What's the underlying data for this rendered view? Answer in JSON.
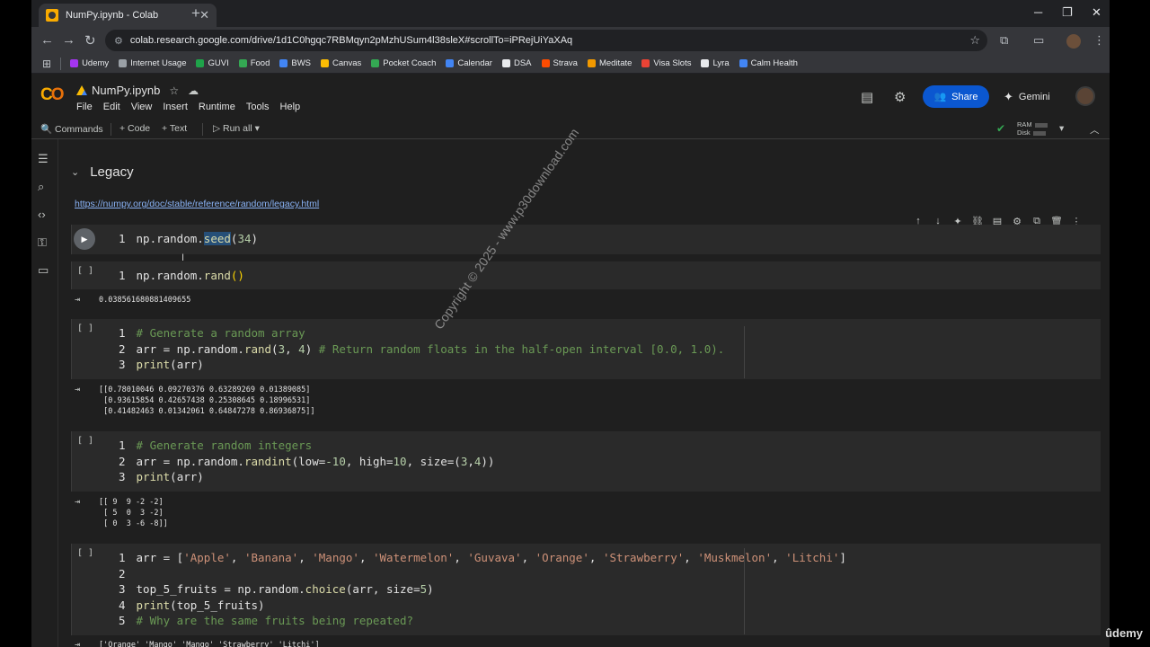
{
  "browser": {
    "tab_title": "NumPy.ipynb - Colab",
    "url": "colab.research.google.com/drive/1d1C0hgqc7RBMqyn2pMzhUSum4l38sleX#scrollTo=iPRejUiYaXAq",
    "bookmarks": [
      {
        "label": "Udemy",
        "color": "#a435f0"
      },
      {
        "label": "Internet Usage",
        "color": "#9aa0a6"
      },
      {
        "label": "GUVI",
        "color": "#1fa34a"
      },
      {
        "label": "Food",
        "color": "#34a853"
      },
      {
        "label": "BWS",
        "color": "#4285f4"
      },
      {
        "label": "Canvas",
        "color": "#fbbc04"
      },
      {
        "label": "Pocket Coach",
        "color": "#34a853"
      },
      {
        "label": "Calendar",
        "color": "#4285f4"
      },
      {
        "label": "DSA",
        "color": "#e8eaed"
      },
      {
        "label": "Strava",
        "color": "#fc4c02"
      },
      {
        "label": "Meditate",
        "color": "#f29900"
      },
      {
        "label": "Visa Slots",
        "color": "#ea4335"
      },
      {
        "label": "Lyra",
        "color": "#e8eaed"
      },
      {
        "label": "Calm Health",
        "color": "#4285f4"
      }
    ]
  },
  "colab": {
    "notebook_title": "NumPy.ipynb",
    "menu": [
      "File",
      "Edit",
      "View",
      "Insert",
      "Runtime",
      "Tools",
      "Help"
    ],
    "share_label": "Share",
    "gemini_label": "Gemini",
    "commands_label": "Commands",
    "code_label": "+ Code",
    "text_label": "+ Text",
    "run_all_label": "Run all",
    "ram_label": "RAM",
    "disk_label": "Disk"
  },
  "notebook": {
    "section_title": "Legacy",
    "link": "https://numpy.org/doc/stable/reference/random/legacy.html",
    "outputs": {
      "rand": "0.038561680881409655",
      "rand_array": "[[0.78010046 0.09270376 0.63289269 0.01389085]\n [0.93615854 0.42657438 0.25308645 0.18996531]\n [0.41482463 0.01342061 0.64847278 0.86936875]]",
      "randint": "[[ 9  9 -2 -2]\n [ 5  0  3 -2]\n [ 0  3 -6 -8]]",
      "choice": "['Orange' 'Mango' 'Mango' 'Strawberry' 'Litchi']"
    }
  },
  "overlay": {
    "watermark": "Copyright © 2025 - www.p30download.com",
    "brand": "ûdemy"
  }
}
